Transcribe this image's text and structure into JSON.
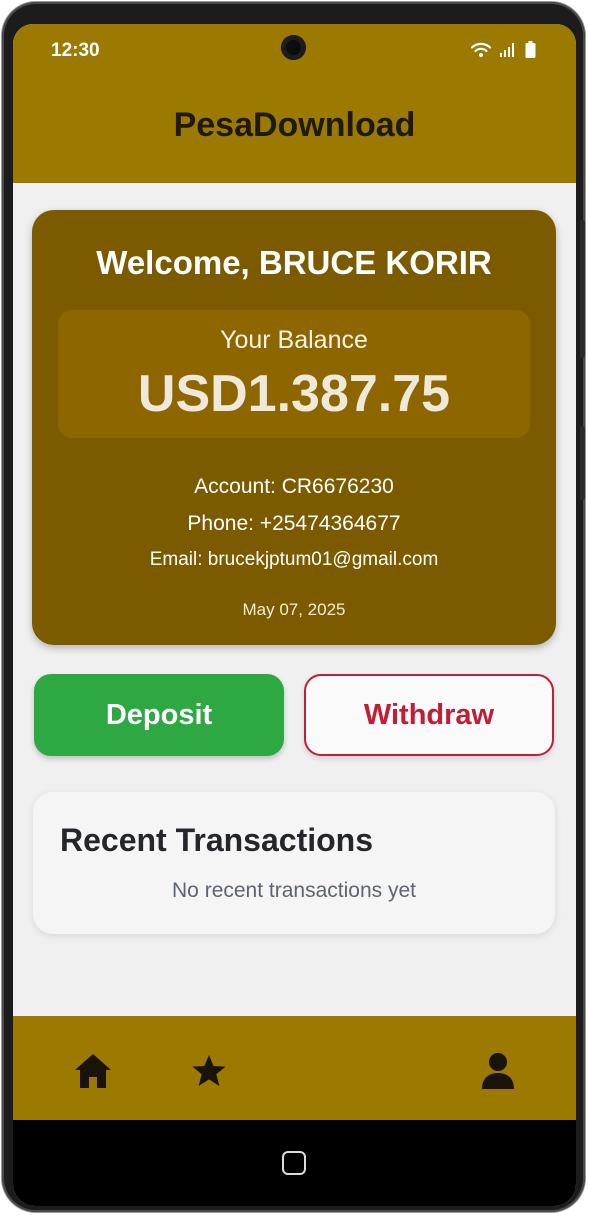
{
  "status_bar": {
    "time": "12:30",
    "icons": [
      "wifi-icon",
      "signal-icon",
      "battery-icon"
    ]
  },
  "header": {
    "title": "PesaDownload"
  },
  "account_card": {
    "welcome": "Welcome, BRUCE KORIR",
    "balance_label": "Your Balance",
    "balance_value": "USD1.387.75",
    "account": "Account: CR6676230",
    "phone": "Phone: +25474364677",
    "email": "Email: brucekjptum01@gmail.com",
    "date": "May 07, 2025"
  },
  "actions": {
    "deposit_label": "Deposit",
    "withdraw_label": "Withdraw"
  },
  "transactions": {
    "title": "Recent Transactions",
    "empty_message": "No recent transactions yet"
  },
  "bottom_nav": {
    "items": [
      "home-icon",
      "star-icon",
      "profile-icon"
    ]
  },
  "colors": {
    "brand": "#9c7900",
    "card": "#7b5a00",
    "deposit": "#2ea843",
    "withdraw": "#c11d36"
  }
}
